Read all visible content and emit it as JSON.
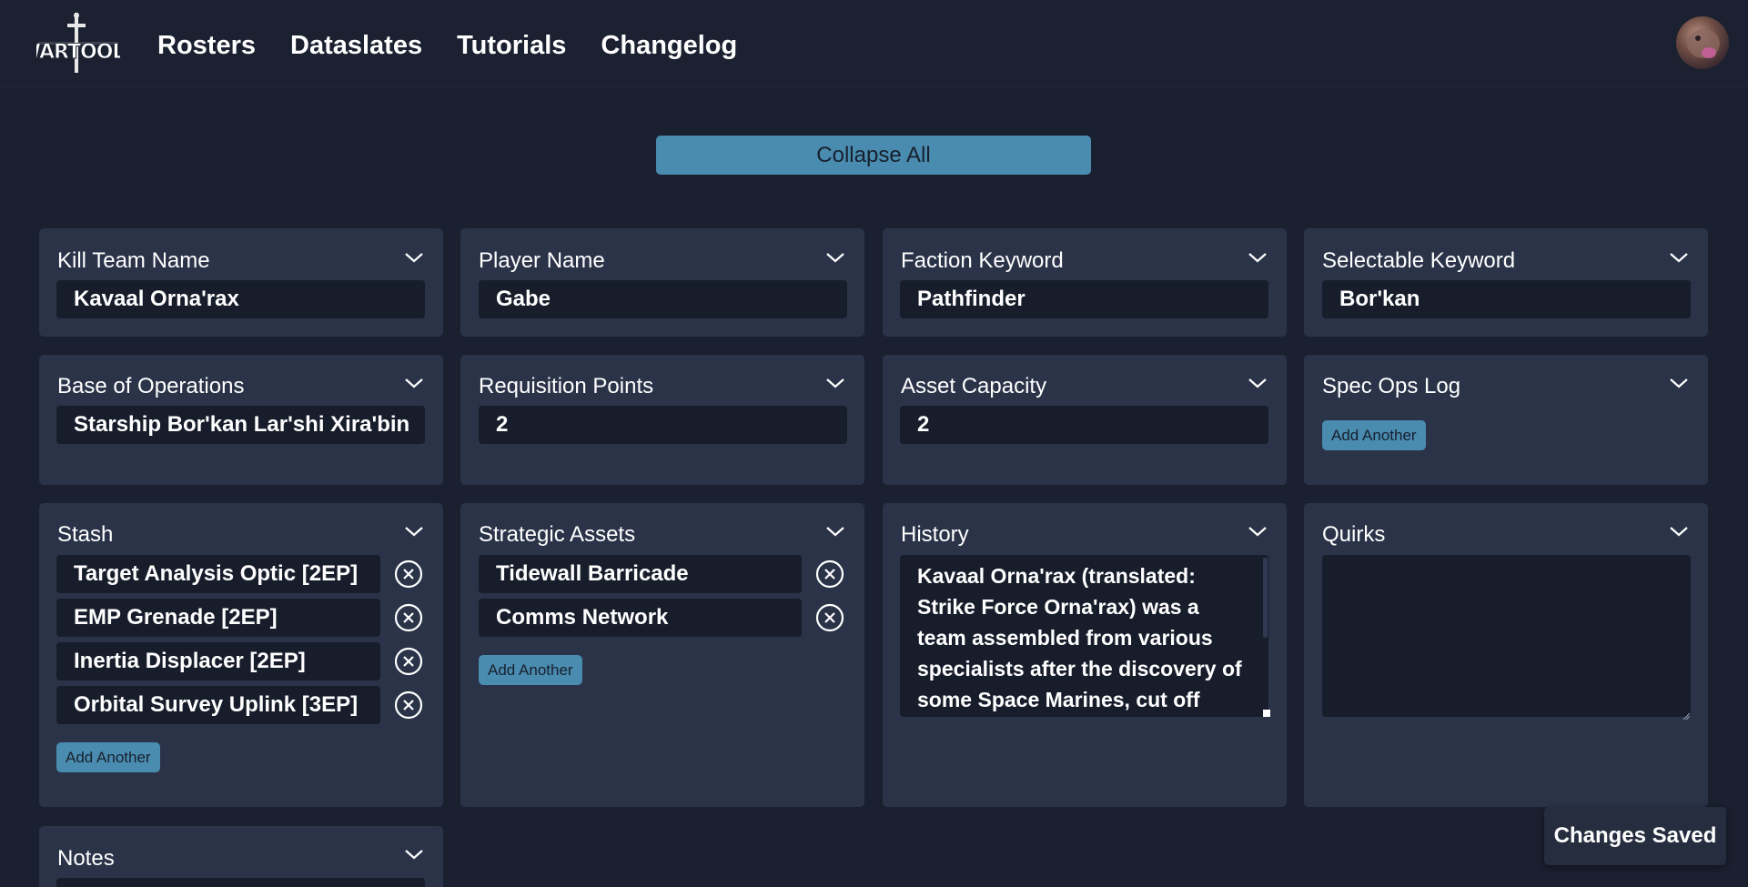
{
  "nav": {
    "logo_alt": "WarTools",
    "links": [
      "Rosters",
      "Dataslates",
      "Tutorials",
      "Changelog"
    ]
  },
  "collapse_all_label": "Collapse All",
  "fields": {
    "kill_team_name": {
      "label": "Kill Team Name",
      "value": "Kavaal Orna'rax"
    },
    "player_name": {
      "label": "Player Name",
      "value": "Gabe"
    },
    "faction_keyword": {
      "label": "Faction Keyword",
      "value": "Pathfinder"
    },
    "selectable_keyword": {
      "label": "Selectable Keyword",
      "value": "Bor'kan"
    },
    "base_of_operations": {
      "label": "Base of Operations",
      "value": "Starship Bor'kan Lar'shi Xira'bin"
    },
    "requisition_points": {
      "label": "Requisition Points",
      "value": "2"
    },
    "asset_capacity": {
      "label": "Asset Capacity",
      "value": "2"
    },
    "spec_ops_log": {
      "label": "Spec Ops Log",
      "add_label": "Add Another"
    },
    "stash": {
      "label": "Stash",
      "items": [
        "Target Analysis Optic [2EP]",
        "EMP Grenade [2EP]",
        "Inertia Displacer [2EP]",
        "Orbital Survey Uplink [3EP]"
      ],
      "add_label": "Add Another"
    },
    "strategic_assets": {
      "label": "Strategic Assets",
      "items": [
        "Tidewall Barricade",
        "Comms Network"
      ],
      "add_label": "Add Another"
    },
    "history": {
      "label": "History",
      "text": "Kavaal Orna'rax (translated: Strike Force Orna'rax) was a team assembled from various specialists after the discovery of some Space Marines, cut off"
    },
    "quirks": {
      "label": "Quirks",
      "text": ""
    },
    "notes": {
      "label": "Notes"
    }
  },
  "toast": "Changes Saved",
  "colors": {
    "background": "#1a2030",
    "card": "#2a3348",
    "input": "#171d2b",
    "accent": "#4a8bb0"
  },
  "icons": {
    "chevron": "chevron-down-icon",
    "remove": "close-circle-icon"
  }
}
